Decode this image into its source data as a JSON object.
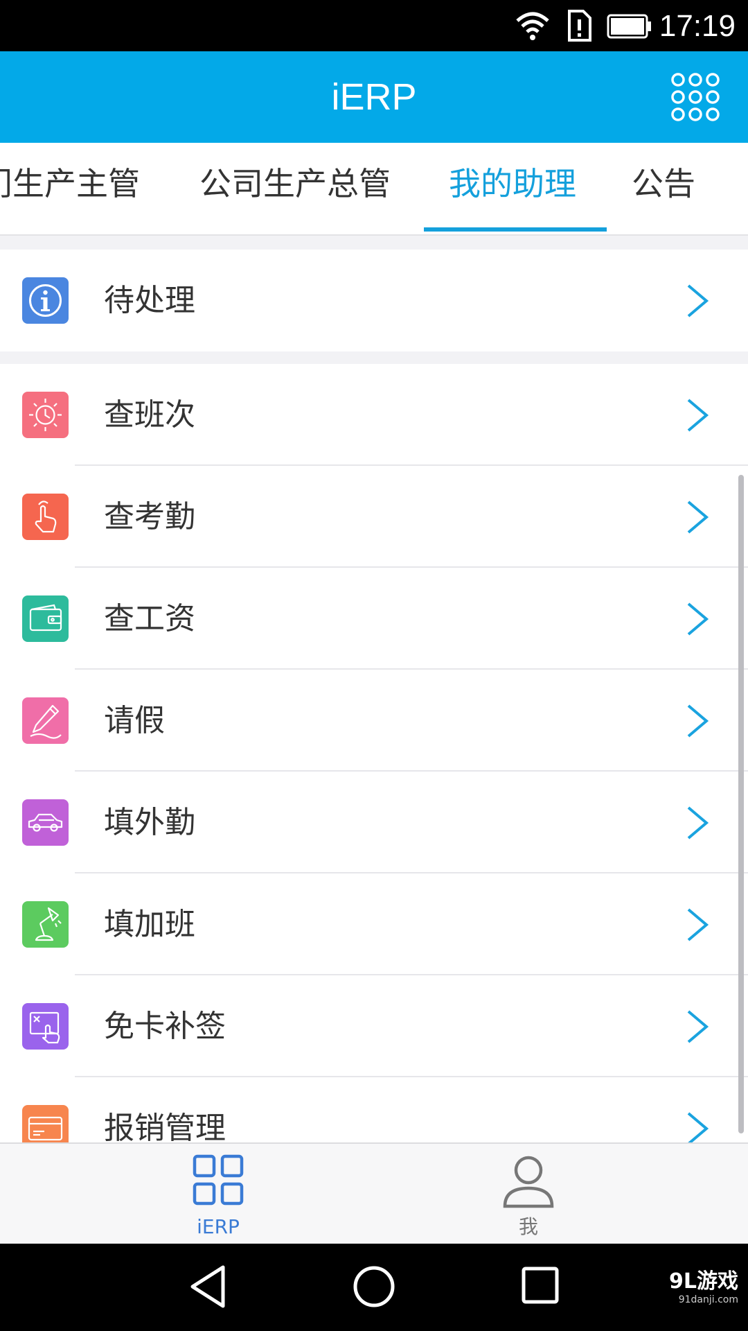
{
  "status_bar": {
    "time": "17:19",
    "icons": [
      "wifi-icon",
      "sim-alert-icon",
      "battery-icon"
    ]
  },
  "header": {
    "title": "iERP",
    "menu_icon": "grid-dots-icon"
  },
  "tabs": [
    {
      "label": "门生产主管",
      "active": false
    },
    {
      "label": "公司生产总管",
      "active": false
    },
    {
      "label": "我的助理",
      "active": true
    },
    {
      "label": "公告",
      "active": false
    }
  ],
  "pending": {
    "label": "待处理",
    "icon": "info-icon",
    "color": "#4a86e0"
  },
  "menu": [
    {
      "label": "查班次",
      "icon": "sun-clock-icon",
      "color": "#f56f7f"
    },
    {
      "label": "查考勤",
      "icon": "touch-hand-icon",
      "color": "#f5664f"
    },
    {
      "label": "查工资",
      "icon": "wallet-icon",
      "color": "#2dbb9c"
    },
    {
      "label": "请假",
      "icon": "pen-icon",
      "color": "#f06ea8"
    },
    {
      "label": "填外勤",
      "icon": "car-icon",
      "color": "#c061d8"
    },
    {
      "label": "填加班",
      "icon": "desk-lamp-icon",
      "color": "#5ccb5f"
    },
    {
      "label": "免卡补签",
      "icon": "card-tap-icon",
      "color": "#9a63ec"
    },
    {
      "label": "报销管理",
      "icon": "credit-card-icon",
      "color": "#f7854e"
    }
  ],
  "bottom_nav": [
    {
      "label": "iERP",
      "icon": "apps-grid-icon",
      "active": true
    },
    {
      "label": "我",
      "icon": "person-icon",
      "active": false
    }
  ],
  "colors": {
    "accent": "#03a9e8",
    "tab_active": "#14a0dc",
    "chevron": "#1aa3df",
    "nav_active": "#3a7bd5",
    "nav_inactive": "#777777"
  },
  "watermark": {
    "text": "9L游戏",
    "sub": "91danji.com"
  }
}
